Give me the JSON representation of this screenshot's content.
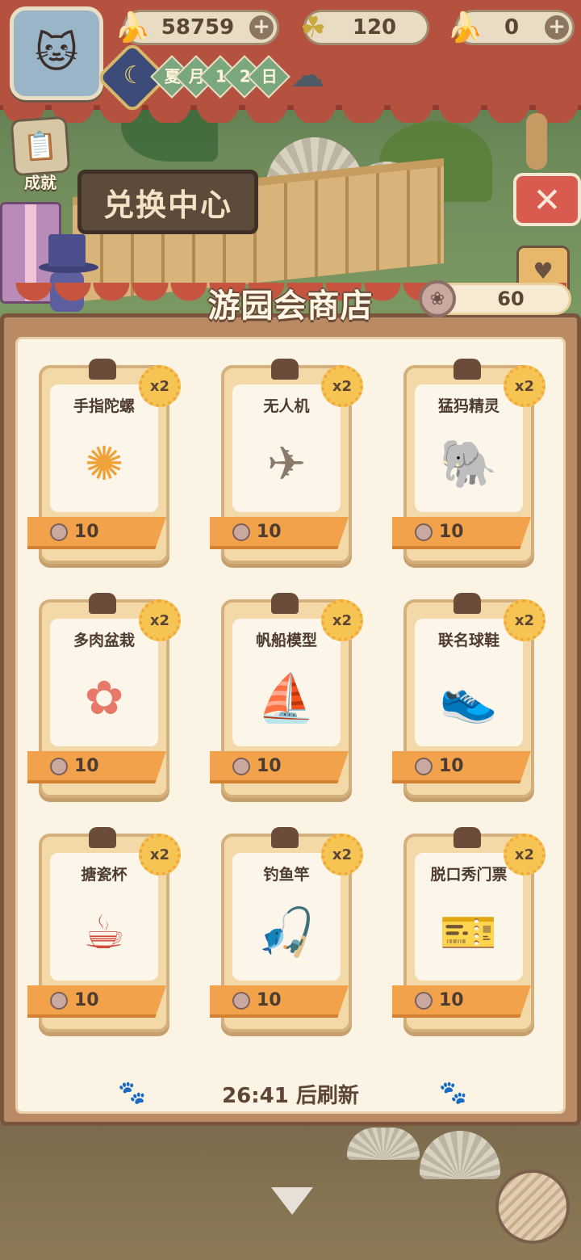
{
  "hud": {
    "bananas": "58759",
    "clovers": "120",
    "blue_bananas": "0",
    "date_chars": [
      "夏",
      "月",
      "1",
      "2",
      "日"
    ],
    "weather_icon": "rain-cloud-icon"
  },
  "side": {
    "achievement_label": "成就",
    "exchange_sign": "兑换中心"
  },
  "shop": {
    "title": "游园会商店",
    "currency_amount": "60",
    "refresh_text": "26:41 后刷新",
    "items": [
      {
        "name": "手指陀螺",
        "badge": "x2",
        "price": "10",
        "icon": "fidget-spinner-icon",
        "glyph": "✺",
        "color": "#f0a23a"
      },
      {
        "name": "无人机",
        "badge": "x2",
        "price": "10",
        "icon": "drone-icon",
        "glyph": "✈",
        "color": "#8a7a6c"
      },
      {
        "name": "猛犸精灵",
        "badge": "x2",
        "price": "10",
        "icon": "mammoth-spirit-icon",
        "glyph": "🐘",
        "color": "#6fbad4"
      },
      {
        "name": "多肉盆栽",
        "badge": "x2",
        "price": "10",
        "icon": "succulent-pot-icon",
        "glyph": "✿",
        "color": "#e7786a"
      },
      {
        "name": "帆船模型",
        "badge": "x2",
        "price": "10",
        "icon": "sailboat-icon",
        "glyph": "⛵",
        "color": "#4fa9c7"
      },
      {
        "name": "联名球鞋",
        "badge": "x2",
        "price": "10",
        "icon": "sneaker-icon",
        "glyph": "👟",
        "color": "#c9402f"
      },
      {
        "name": "搪瓷杯",
        "badge": "x2",
        "price": "10",
        "icon": "enamel-mug-icon",
        "glyph": "☕",
        "color": "#d24a3c"
      },
      {
        "name": "钓鱼竿",
        "badge": "x2",
        "price": "10",
        "icon": "fishing-rod-icon",
        "glyph": "🎣",
        "color": "#a85a3c"
      },
      {
        "name": "脱口秀门票",
        "badge": "x2",
        "price": "10",
        "icon": "show-ticket-icon",
        "glyph": "🎫",
        "color": "#e0603e"
      }
    ]
  }
}
